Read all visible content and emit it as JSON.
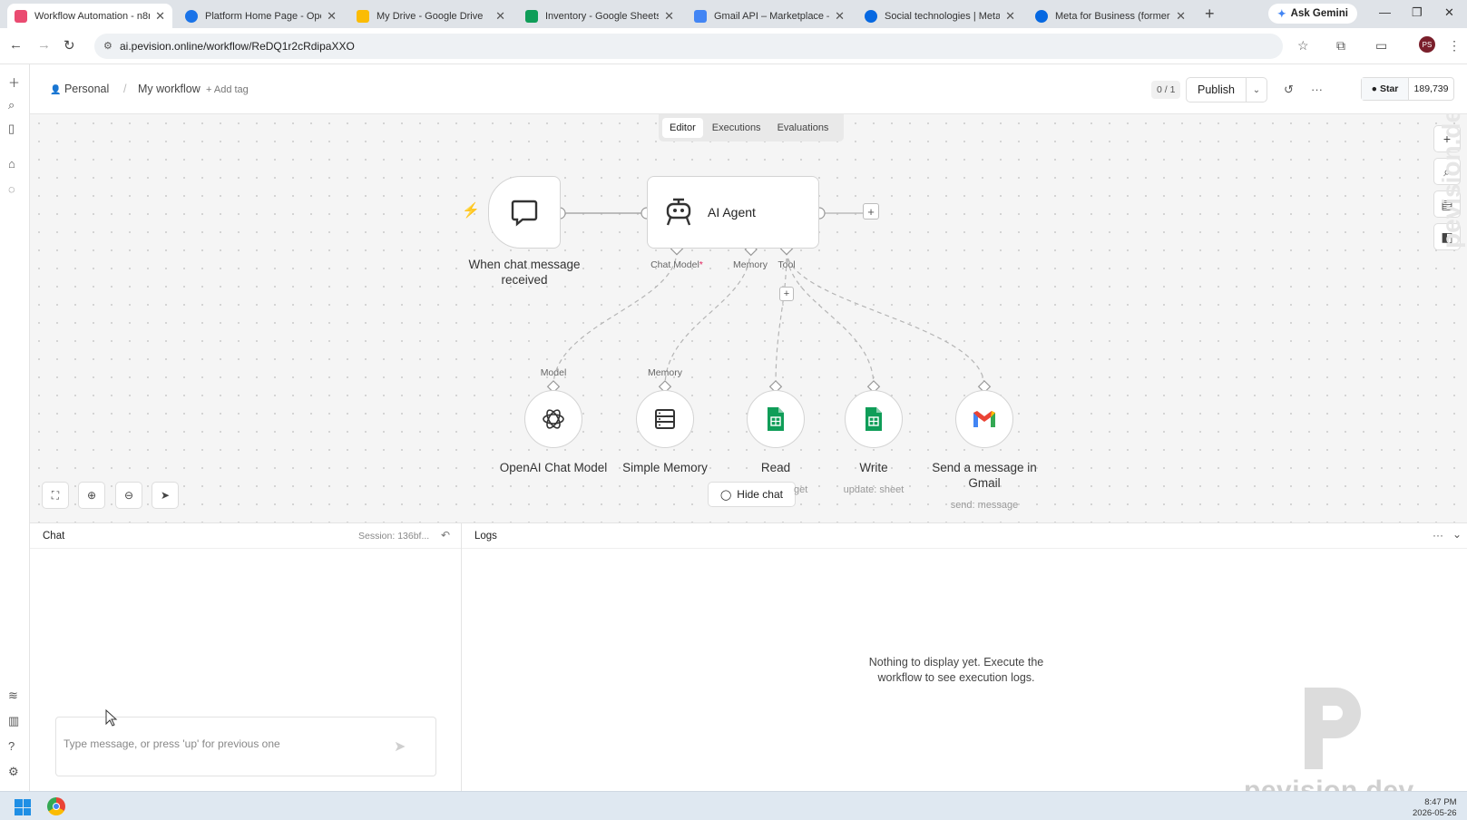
{
  "browser": {
    "tabs": [
      {
        "title": "Workflow Automation - n8n",
        "color": "#ea4b71"
      },
      {
        "title": "Platform Home Page - Open",
        "color": "#1a73e8"
      },
      {
        "title": "My Drive - Google Drive",
        "color": "#fbbc04"
      },
      {
        "title": "Inventory - Google Sheets",
        "color": "#0f9d58"
      },
      {
        "title": "Gmail API – Marketplace – G",
        "color": "#4285f4"
      },
      {
        "title": "Social technologies | Meta fo",
        "color": "#0668e1"
      },
      {
        "title": "Meta for Business (formerly",
        "color": "#0668e1"
      }
    ],
    "ask_gemini": "Ask Gemini",
    "url": "ai.pevision.online/workflow/ReDQ1r2cRdipaXXO",
    "profile_initials": "PS"
  },
  "header": {
    "project": "Personal",
    "workflow_name": "My workflow",
    "add_tag": "+ Add tag",
    "counter": "0 / 1",
    "publish": "Publish",
    "github_star": "Star",
    "github_count": "189,739"
  },
  "view_tabs": [
    "Editor",
    "Executions",
    "Evaluations"
  ],
  "nodes": {
    "trigger": {
      "label": "When chat message received"
    },
    "agent": {
      "label": "AI Agent",
      "ports": {
        "chat_model": "Chat Model",
        "memory": "Memory",
        "tool": "Tool"
      }
    },
    "openai": {
      "label": "OpenAI Chat Model",
      "port": "Model"
    },
    "memory": {
      "label": "Simple Memory",
      "port": "Memory"
    },
    "read": {
      "label": "Read",
      "sub": "get"
    },
    "write": {
      "label": "Write",
      "sub": "update: sheet"
    },
    "gmail": {
      "label": "Send a message in Gmail",
      "sub": "send: message"
    }
  },
  "canvas": {
    "hide_chat": "Hide chat",
    "side_watermark": "pevision.dev"
  },
  "chat": {
    "title": "Chat",
    "session": "Session: 136bf...",
    "placeholder": "Type message, or press 'up' for previous one"
  },
  "logs": {
    "title": "Logs",
    "empty": "Nothing to display yet. Execute the workflow to see execution logs."
  },
  "watermark": "pevision.dev",
  "taskbar": {
    "time": "8:47 PM",
    "date": "2026-05-26"
  }
}
